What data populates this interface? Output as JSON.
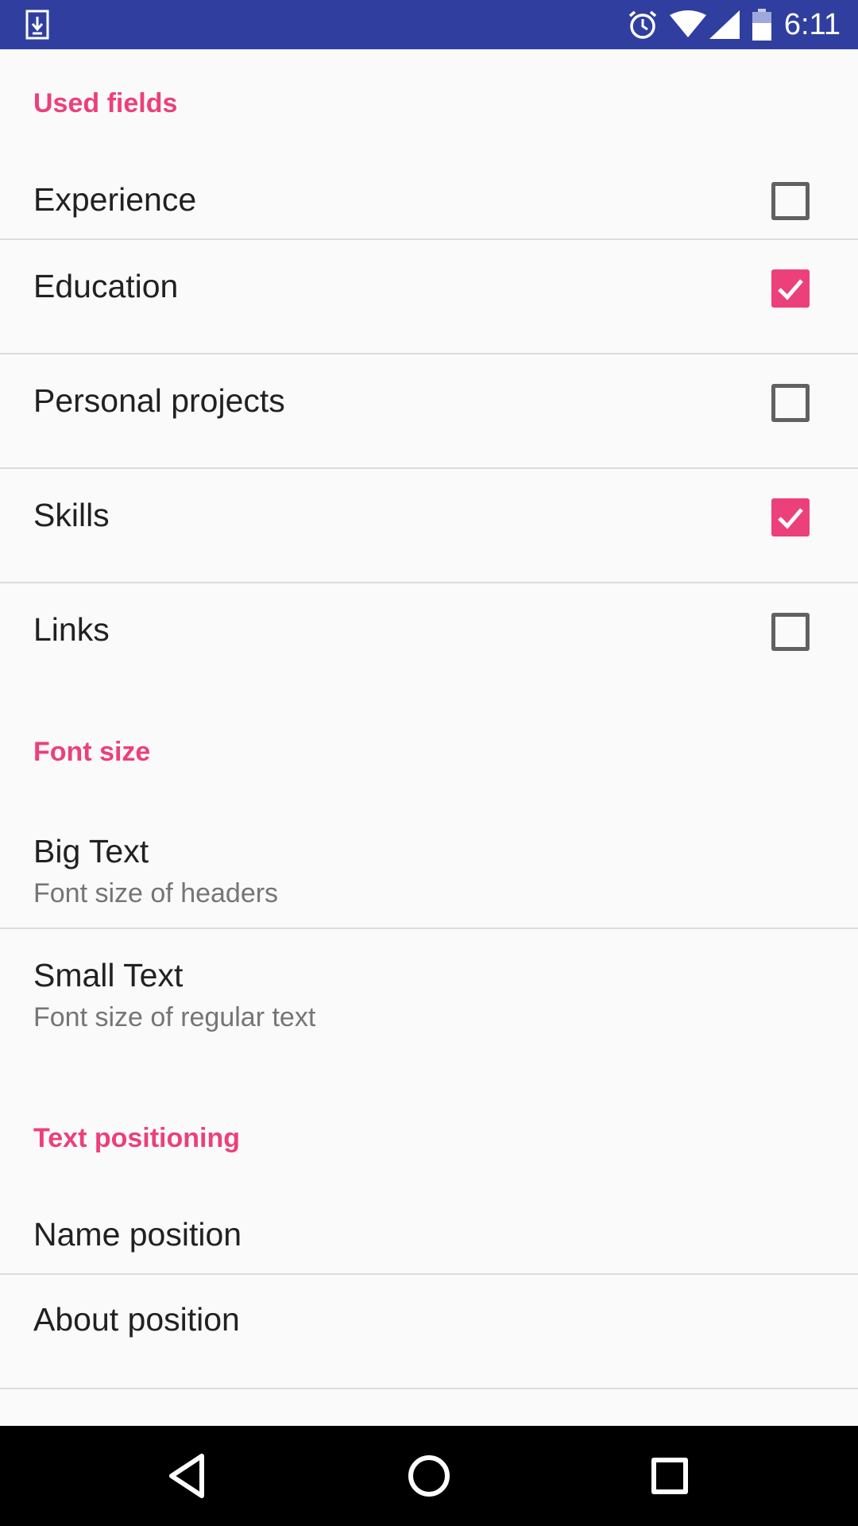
{
  "status_bar": {
    "time": "6:11",
    "icons": [
      "download-notification-icon",
      "alarm-icon",
      "wifi-icon",
      "cell-signal-icon",
      "battery-icon"
    ],
    "background_color": "#303f9f"
  },
  "sections": {
    "used_fields": {
      "header": "Used fields",
      "items": [
        {
          "label": "Experience",
          "checked": false
        },
        {
          "label": "Education",
          "checked": true
        },
        {
          "label": "Personal projects",
          "checked": false
        },
        {
          "label": "Skills",
          "checked": true
        },
        {
          "label": "Links",
          "checked": false
        }
      ]
    },
    "font_size": {
      "header": "Font size",
      "items": [
        {
          "title": "Big Text",
          "summary": "Font size of headers"
        },
        {
          "title": "Small Text",
          "summary": "Font size of regular text"
        }
      ]
    },
    "text_positioning": {
      "header": "Text positioning",
      "items": [
        {
          "title": "Name position"
        },
        {
          "title": "About position"
        }
      ]
    }
  },
  "nav_bar": {
    "buttons": [
      "back-icon",
      "home-icon",
      "recents-icon"
    ]
  },
  "colors": {
    "accent": "#ec407a",
    "primary_dark": "#303f9f",
    "background": "#fafafa"
  }
}
